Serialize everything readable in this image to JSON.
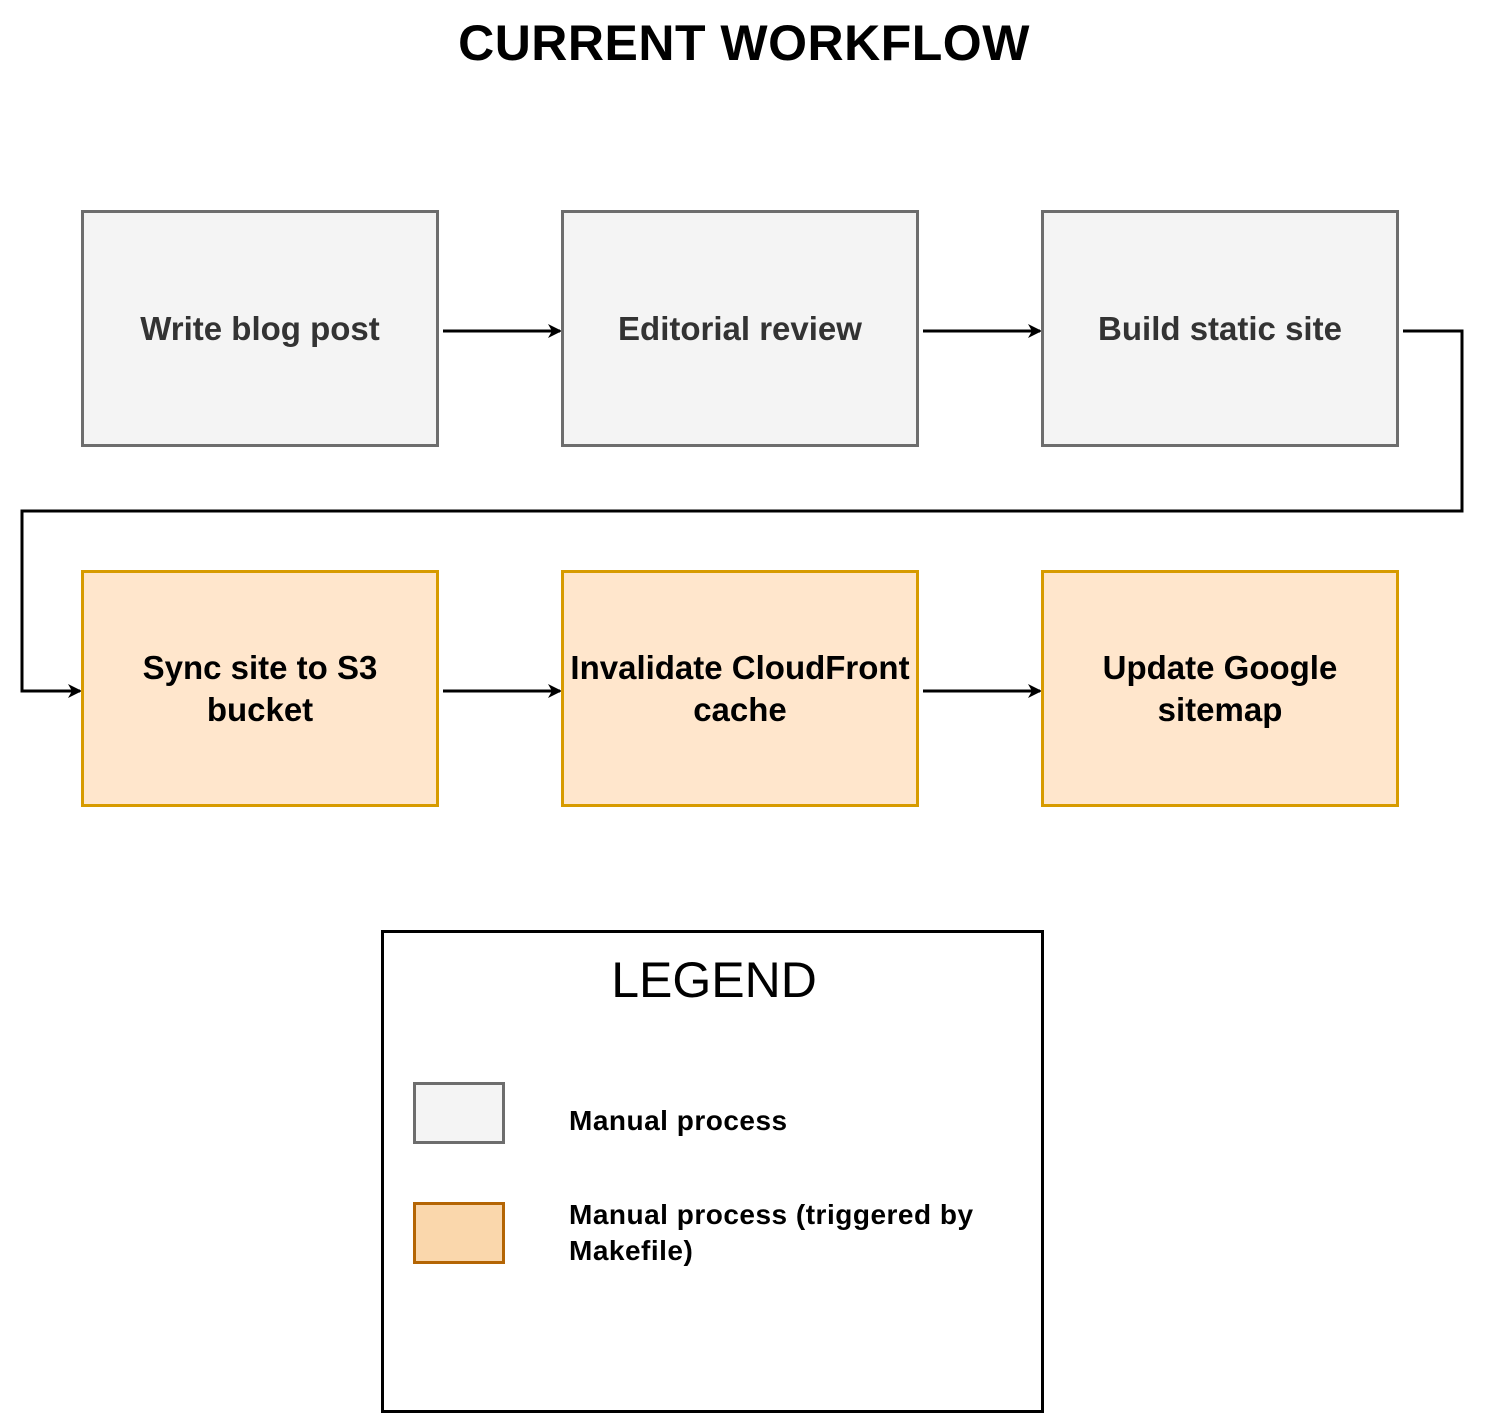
{
  "title": "CURRENT WORKFLOW",
  "steps": [
    {
      "label": "Write blog post",
      "type": "manual"
    },
    {
      "label": "Editorial review",
      "type": "manual"
    },
    {
      "label": "Build static site",
      "type": "manual"
    },
    {
      "label": "Sync site to S3 bucket",
      "type": "makefile"
    },
    {
      "label": "Invalidate CloudFront cache",
      "type": "makefile"
    },
    {
      "label": "Update Google sitemap",
      "type": "makefile"
    }
  ],
  "connections": [
    {
      "from": "Write blog post",
      "to": "Editorial review"
    },
    {
      "from": "Editorial review",
      "to": "Build static site"
    },
    {
      "from": "Build static site",
      "to": "Sync site to S3 bucket"
    },
    {
      "from": "Sync site to S3 bucket",
      "to": "Invalidate CloudFront cache"
    },
    {
      "from": "Invalidate CloudFront cache",
      "to": "Update Google sitemap"
    }
  ],
  "legend": {
    "title": "LEGEND",
    "items": [
      {
        "label": "Manual process",
        "fill": "#f4f4f4",
        "stroke": "#6d6d6d"
      },
      {
        "label": "Manual process (triggered by Makefile)",
        "fill": "#fad7ac",
        "stroke": "#b46504"
      }
    ]
  },
  "colors": {
    "manual_fill": "#f4f4f4",
    "manual_stroke": "#6d6d6d",
    "manual_text": "#333333",
    "makefile_fill": "#ffe6cc",
    "makefile_stroke": "#d79b00",
    "makefile_text": "#000000"
  }
}
